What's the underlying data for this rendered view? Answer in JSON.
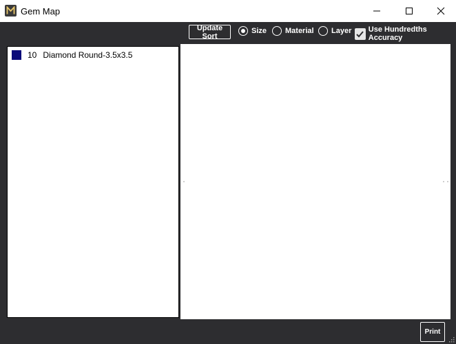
{
  "window": {
    "title": "Gem Map",
    "icon": "m-logo-icon",
    "controls": [
      "minimize-icon",
      "maximize-icon",
      "close-icon"
    ]
  },
  "toolbar": {
    "update_label": "Update Sort",
    "sort_options": [
      {
        "label": "Size",
        "selected": true
      },
      {
        "label": "Material",
        "selected": false
      },
      {
        "label": "Layer",
        "selected": false
      }
    ],
    "hundredths": {
      "label": "Use Hundredths Accuracy",
      "checked": true
    }
  },
  "gem_list": [
    {
      "count": "10",
      "name": "Diamond Round-3.5x3.5",
      "color": "#0b0b7a"
    }
  ],
  "footer": {
    "print_label": "Print"
  },
  "colors": {
    "chrome": "#2d2d30",
    "panel": "#ffffff"
  }
}
